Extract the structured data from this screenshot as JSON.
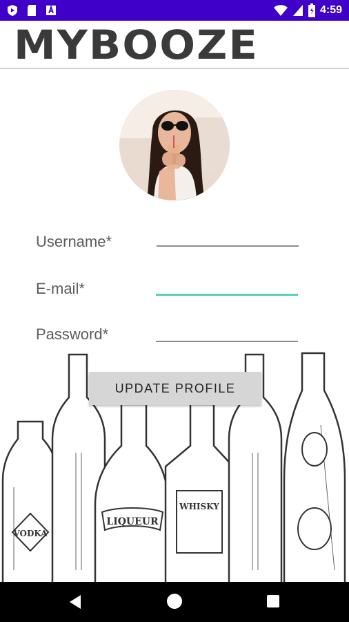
{
  "status_bar": {
    "time": "4:59",
    "icons": [
      "shield-notification-icon",
      "sd-card-icon",
      "a-notification-icon",
      "wifi-icon",
      "signal-icon",
      "battery-icon"
    ]
  },
  "header": {
    "title": "MYBOOZE"
  },
  "profile": {
    "avatar": "profile-photo"
  },
  "form": {
    "username_label": "Username*",
    "email_label": "E-mail*",
    "password_label": "Password*",
    "username_value": "",
    "email_value": "",
    "password_value": ""
  },
  "actions": {
    "update_label": "UPDATE PROFILE"
  },
  "illustration": {
    "labels": [
      "VODKA",
      "LIQUEUR",
      "WHISKY"
    ]
  },
  "colors": {
    "status_bar": "#3f00c9",
    "focus_line": "#59d0bf",
    "nav_bar": "#000000"
  }
}
